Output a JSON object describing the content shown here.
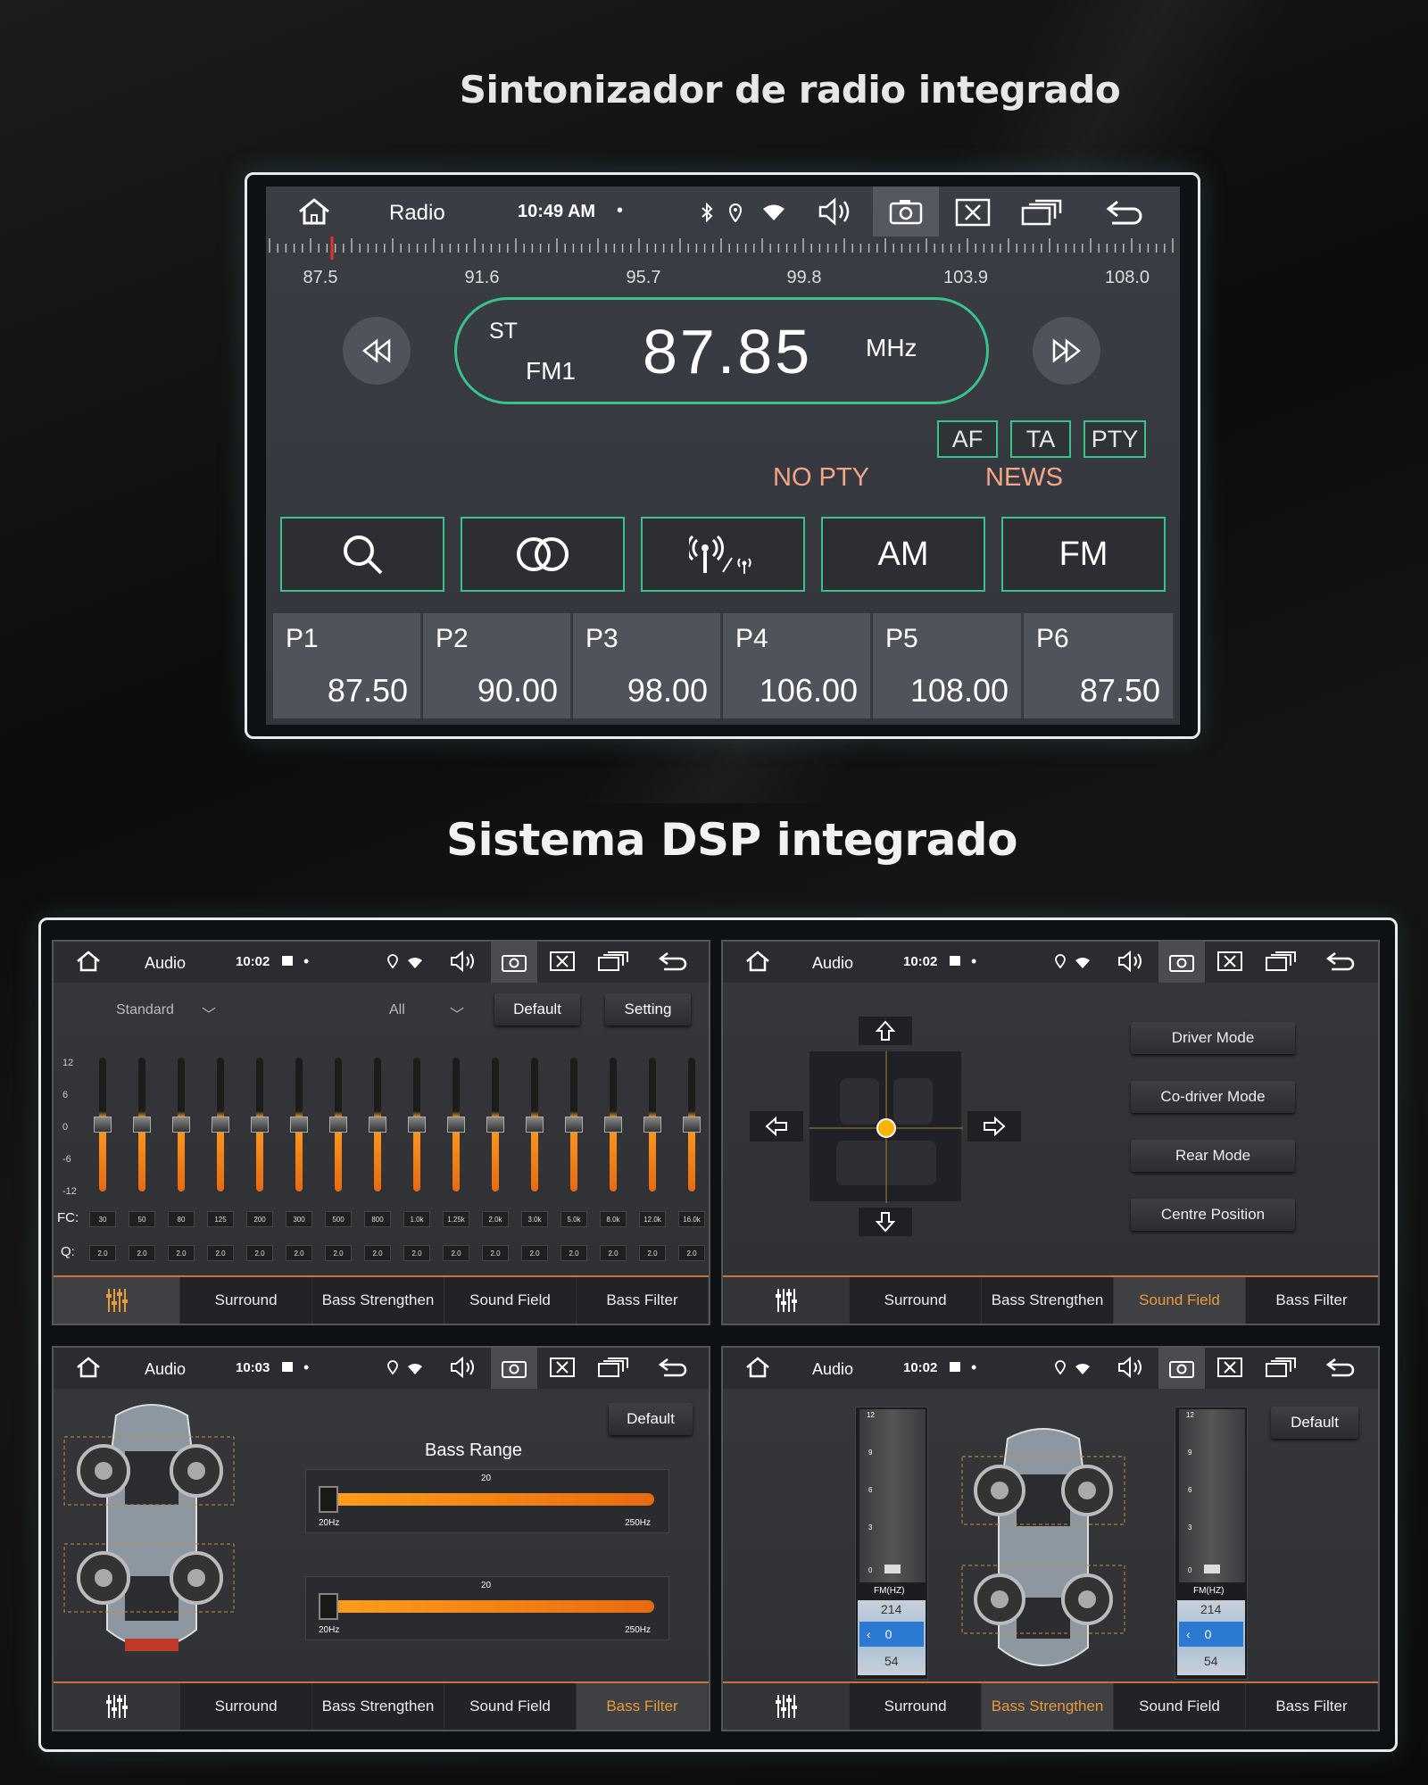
{
  "headings": {
    "radio": "Sintonizador de radio integrado",
    "dsp": "Sistema DSP integrado"
  },
  "radio": {
    "app": "Radio",
    "time": "10:49 AM",
    "dot": "•",
    "scale_labels": [
      "87.5",
      "91.6",
      "95.7",
      "99.8",
      "103.9",
      "108.0"
    ],
    "stereo": "ST",
    "band": "FM1",
    "frequency": "87.85",
    "unit": "MHz",
    "flags": [
      "AF",
      "TA",
      "PTY"
    ],
    "pty_status": "NO PTY",
    "pty_type": "NEWS",
    "function_buttons": [
      "AM",
      "FM"
    ],
    "presets": [
      {
        "name": "P1",
        "freq": "87.50"
      },
      {
        "name": "P2",
        "freq": "90.00"
      },
      {
        "name": "P3",
        "freq": "98.00"
      },
      {
        "name": "P4",
        "freq": "106.00"
      },
      {
        "name": "P5",
        "freq": "108.00"
      },
      {
        "name": "P6",
        "freq": "87.50"
      }
    ],
    "accent": "#39c28a"
  },
  "dsp": {
    "tabs": [
      "Surround",
      "Bass Strengthen",
      "Sound Field",
      "Bass Filter"
    ],
    "accent": "#e89a3c",
    "eq_panel": {
      "app": "Audio",
      "time": "10:02",
      "dot": "•",
      "preset": "Standard",
      "scope": "All",
      "default_btn": "Default",
      "setting_btn": "Setting",
      "db_labels": [
        "12",
        "6",
        "0",
        "-6",
        "-12"
      ],
      "fc_label": "FC:",
      "q_label": "Q:",
      "fc": [
        "30",
        "50",
        "80",
        "125",
        "200",
        "300",
        "500",
        "800",
        "1.0k",
        "1.25k",
        "2.0k",
        "3.0k",
        "5.0k",
        "8.0k",
        "12.0k",
        "16.0k"
      ],
      "q": [
        "2.0",
        "2.0",
        "2.0",
        "2.0",
        "2.0",
        "2.0",
        "2.0",
        "2.0",
        "2.0",
        "2.0",
        "2.0",
        "2.0",
        "2.0",
        "2.0",
        "2.0",
        "2.0"
      ]
    },
    "field_panel": {
      "app": "Audio",
      "time": "10:02",
      "dot": "•",
      "modes": [
        "Driver Mode",
        "Co-driver Mode",
        "Rear Mode",
        "Centre Position"
      ],
      "active_tab": "Sound Field"
    },
    "filter_panel": {
      "app": "Audio",
      "time": "10:03",
      "dot": "•",
      "default_btn": "Default",
      "title": "Bass Range",
      "bars": [
        {
          "value": "20",
          "min": "20Hz",
          "max": "250Hz"
        },
        {
          "value": "20",
          "min": "20Hz",
          "max": "250Hz"
        }
      ],
      "active_tab": "Bass Filter"
    },
    "strength_panel": {
      "app": "Audio",
      "time": "10:02",
      "dot": "•",
      "default_btn": "Default",
      "scale": [
        "12",
        "9",
        "6",
        "3",
        "0"
      ],
      "label": "FM(HZ)",
      "values": [
        "214",
        "0",
        "54"
      ],
      "active_tab": "Bass Strengthen"
    }
  }
}
